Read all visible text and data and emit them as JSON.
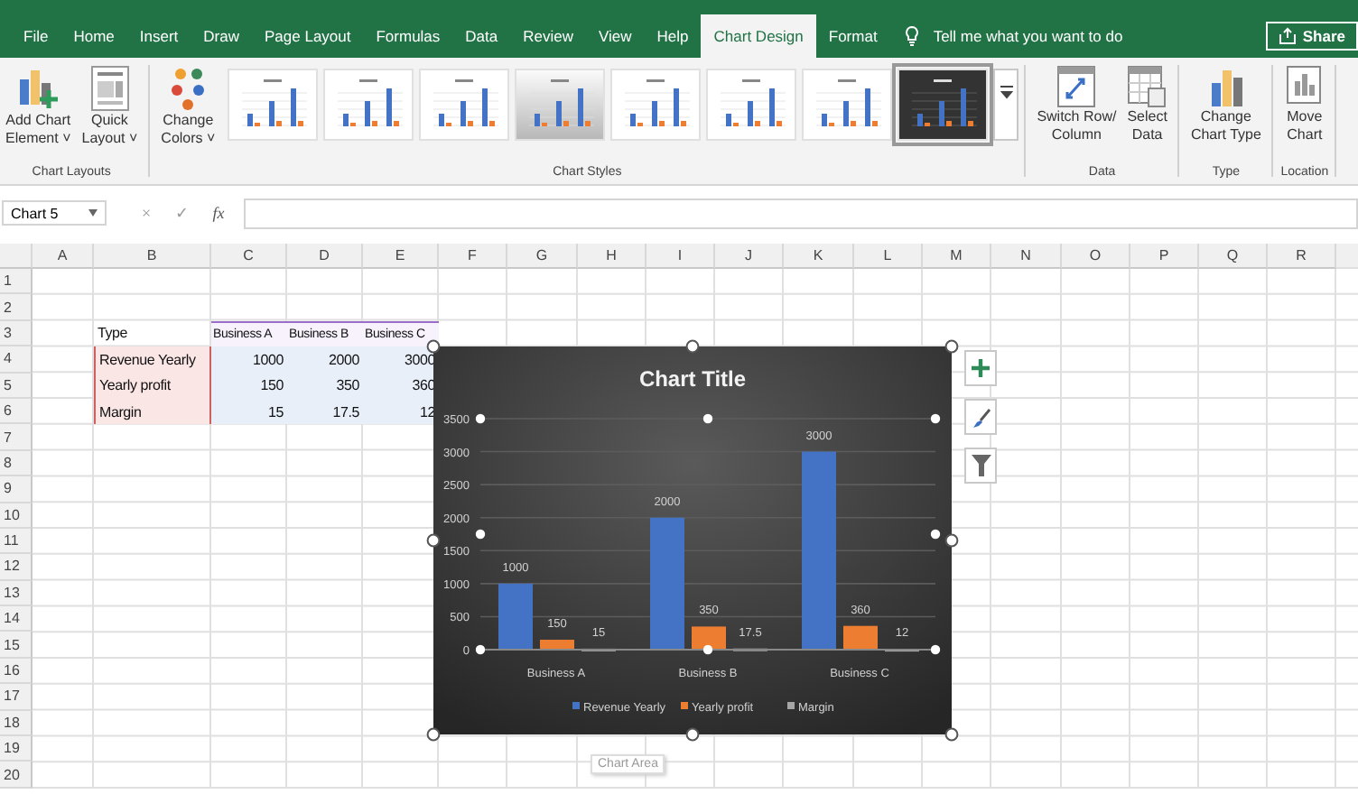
{
  "ribbon_tabs": [
    {
      "label": "File",
      "selected": false
    },
    {
      "label": "Home",
      "selected": false
    },
    {
      "label": "Insert",
      "selected": false
    },
    {
      "label": "Draw",
      "selected": false
    },
    {
      "label": "Page Layout",
      "selected": false
    },
    {
      "label": "Formulas",
      "selected": false
    },
    {
      "label": "Data",
      "selected": false
    },
    {
      "label": "Review",
      "selected": false
    },
    {
      "label": "View",
      "selected": false
    },
    {
      "label": "Help",
      "selected": false
    },
    {
      "label": "Chart Design",
      "selected": true
    },
    {
      "label": "Format",
      "selected": false
    }
  ],
  "tell_me": {
    "placeholder": "Tell me what you want to do"
  },
  "share_button": {
    "label": "Share"
  },
  "ribbon": {
    "chart_layouts": {
      "title": "Chart Layouts",
      "buttons": [
        {
          "kind": "add",
          "lines": [
            "Add Chart",
            "Element ˅"
          ]
        },
        {
          "kind": "layout",
          "lines": [
            "Quick",
            "Layout ˅"
          ]
        }
      ]
    },
    "change_colors": {
      "kind": "colors",
      "lines": [
        "Change",
        "Colors ˅"
      ]
    },
    "chart_styles": {
      "title": "Chart Styles",
      "styles": [
        {
          "kind": "light",
          "selected": false
        },
        {
          "kind": "light",
          "selected": false
        },
        {
          "kind": "light",
          "selected": false
        },
        {
          "kind": "shaded",
          "selected": false
        },
        {
          "kind": "light",
          "selected": false
        },
        {
          "kind": "light",
          "selected": false
        },
        {
          "kind": "light",
          "selected": false
        },
        {
          "kind": "dark",
          "selected": true
        }
      ]
    },
    "data": {
      "title": "Data",
      "buttons": [
        {
          "kind": "switch",
          "lines": [
            "Switch Row/",
            "Column"
          ]
        },
        {
          "kind": "select",
          "lines": [
            "Select",
            "Data"
          ]
        }
      ]
    },
    "type": {
      "title": "Type",
      "buttons": [
        {
          "kind": "type",
          "lines": [
            "Change",
            "Chart Type"
          ]
        }
      ]
    },
    "location": {
      "title": "Location",
      "buttons": [
        {
          "kind": "move",
          "lines": [
            "Move",
            "Chart"
          ]
        }
      ]
    }
  },
  "formula_bar": {
    "name_box": "Chart 5",
    "cancel": "×",
    "enter": "✓",
    "function": "fx"
  },
  "columns": [
    "A",
    "B",
    "C",
    "D",
    "E",
    "F",
    "G",
    "H",
    "I",
    "J",
    "K",
    "L",
    "M",
    "N",
    "O",
    "P",
    "Q",
    "R"
  ],
  "rows": [
    "1",
    "2",
    "3",
    "4",
    "5",
    "6",
    "7",
    "8",
    "9",
    "10",
    "11",
    "12",
    "13",
    "14",
    "15",
    "16",
    "17",
    "18",
    "19",
    "20"
  ],
  "data_table": {
    "header": [
      "Type",
      "Business A",
      "Business B",
      "Business C"
    ],
    "rows": [
      {
        "label": "Revenue Yearly",
        "values": [
          "1000",
          "2000",
          "3000"
        ]
      },
      {
        "label": "Yearly profit",
        "values": [
          "150",
          "350",
          "360"
        ]
      },
      {
        "label": "Margin",
        "values": [
          "15",
          "17.5",
          "12"
        ]
      }
    ]
  },
  "chart": {
    "chart_data": {
      "type": "bar",
      "title": "Chart Title",
      "categories": [
        "Business A",
        "Business B",
        "Business C"
      ],
      "series": [
        {
          "name": "Revenue Yearly",
          "color": "#4472c4",
          "values": [
            1000,
            2000,
            3000
          ]
        },
        {
          "name": "Yearly profit",
          "color": "#ed7d31",
          "values": [
            150,
            350,
            360
          ]
        },
        {
          "name": "Margin",
          "color": "#a5a5a5",
          "values": [
            15,
            17.5,
            12
          ]
        }
      ],
      "ylim": [
        0,
        3500
      ],
      "yticks": [
        0,
        500,
        1000,
        1500,
        2000,
        2500,
        3000,
        3500
      ],
      "data_labels": true,
      "grid": true,
      "legend": true
    },
    "tooltip": "Chart Area"
  }
}
